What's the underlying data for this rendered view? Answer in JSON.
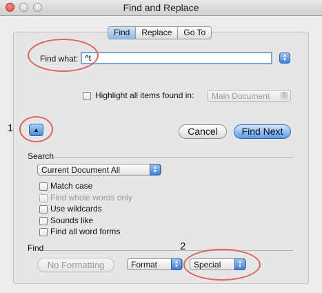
{
  "window": {
    "title": "Find and Replace"
  },
  "tabs": [
    {
      "label": "Find"
    },
    {
      "label": "Replace"
    },
    {
      "label": "Go To"
    }
  ],
  "find": {
    "label": "Find what:",
    "value": "^t",
    "stepper_icon": "up-down-arrows-icon"
  },
  "highlight": {
    "label": "Highlight all items found in:",
    "checked": false,
    "dropdown_value": "Main Document"
  },
  "buttons": {
    "cancel": "Cancel",
    "find_next": "Find Next",
    "no_formatting": "No Formatting"
  },
  "search": {
    "heading": "Search",
    "scope": "Current Document All",
    "options": [
      {
        "label": "Match case",
        "checked": false,
        "enabled": true
      },
      {
        "label": "Find whole words only",
        "checked": false,
        "enabled": false
      },
      {
        "label": "Use wildcards",
        "checked": false,
        "enabled": true
      },
      {
        "label": "Sounds like",
        "checked": false,
        "enabled": true
      },
      {
        "label": "Find all word forms",
        "checked": false,
        "enabled": true
      }
    ]
  },
  "find_section": {
    "heading": "Find",
    "format": "Format",
    "special": "Special"
  },
  "annotations": {
    "one": "1",
    "two": "2",
    "color": "#e0615d"
  },
  "colors": {
    "accent": "#5e9be8"
  }
}
